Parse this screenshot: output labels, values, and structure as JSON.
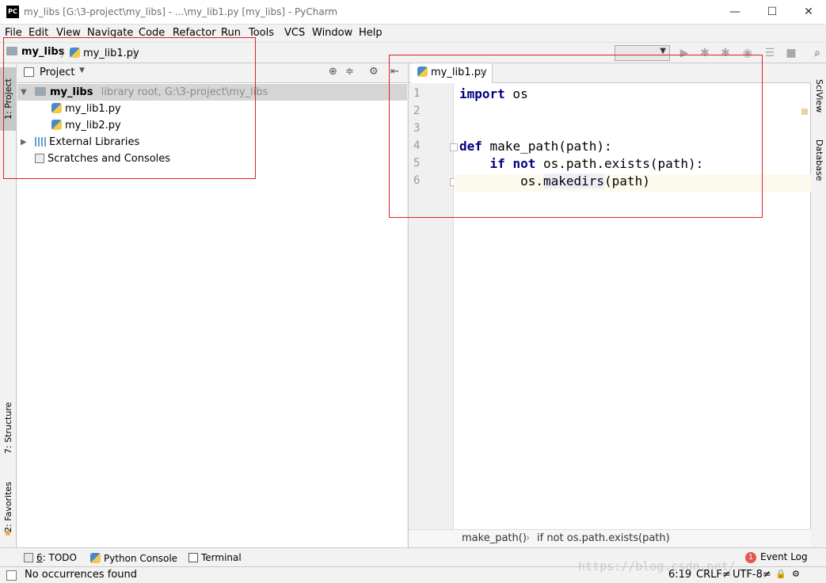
{
  "window": {
    "title": "my_libs [G:\\3-project\\my_libs] - ...\\my_lib1.py [my_libs] - PyCharm",
    "logo": "PC",
    "controls": [
      "—",
      "☐",
      "✕"
    ]
  },
  "menu": [
    "File",
    "Edit",
    "View",
    "Navigate",
    "Code",
    "Refactor",
    "Run",
    "Tools",
    "VCS",
    "Window",
    "Help"
  ],
  "navbar": {
    "project": "my_libs",
    "file": "my_lib1.py",
    "separator": "〉"
  },
  "left_tabs": {
    "project": "1: Project",
    "structure": "7: Structure",
    "favorites": "2: Favorites"
  },
  "right_tabs": {
    "sciview": "SciView",
    "database": "Database"
  },
  "project_panel": {
    "title": "Project",
    "tree": {
      "root_name": "my_libs",
      "root_hint": "library root, G:\\3-project\\my_libs",
      "files": [
        "my_lib1.py",
        "my_lib2.py"
      ],
      "external": "External Libraries",
      "scratches": "Scratches and Consoles"
    }
  },
  "editor": {
    "tab": "my_lib1.py",
    "line_numbers": [
      "1",
      "2",
      "3",
      "4",
      "5",
      "6"
    ],
    "code": {
      "l1_kw": "import",
      "l1_rest": " os",
      "l4_kw": "def",
      "l4_rest": " make_path(path):",
      "l5_indent": "    ",
      "l5_kw1": "if",
      "l5_kw2": "not",
      "l5_rest": " os.path.exists(path):",
      "l6_pre": "        os.",
      "l6_hl": "makedirs",
      "l6_post": "(path)"
    },
    "breadcrumb": {
      "function": "make_path()",
      "condition": "if not os.path.exists(path)"
    }
  },
  "toolwindows": {
    "todo_prefix": "6",
    "todo_label": ": TODO",
    "python_console": "Python Console",
    "terminal": "Terminal",
    "event_log": "Event Log",
    "event_count": "1"
  },
  "status": {
    "message": "No occurrences found",
    "position": "6:19",
    "line_sep": "CRLF≠",
    "encoding": "UTF-8≠"
  },
  "watermark": "https://blog.csdn.net/...",
  "colors": {
    "keyword": "#000080",
    "annotation_box": "#e02020",
    "current_line": "#fcfaed"
  }
}
